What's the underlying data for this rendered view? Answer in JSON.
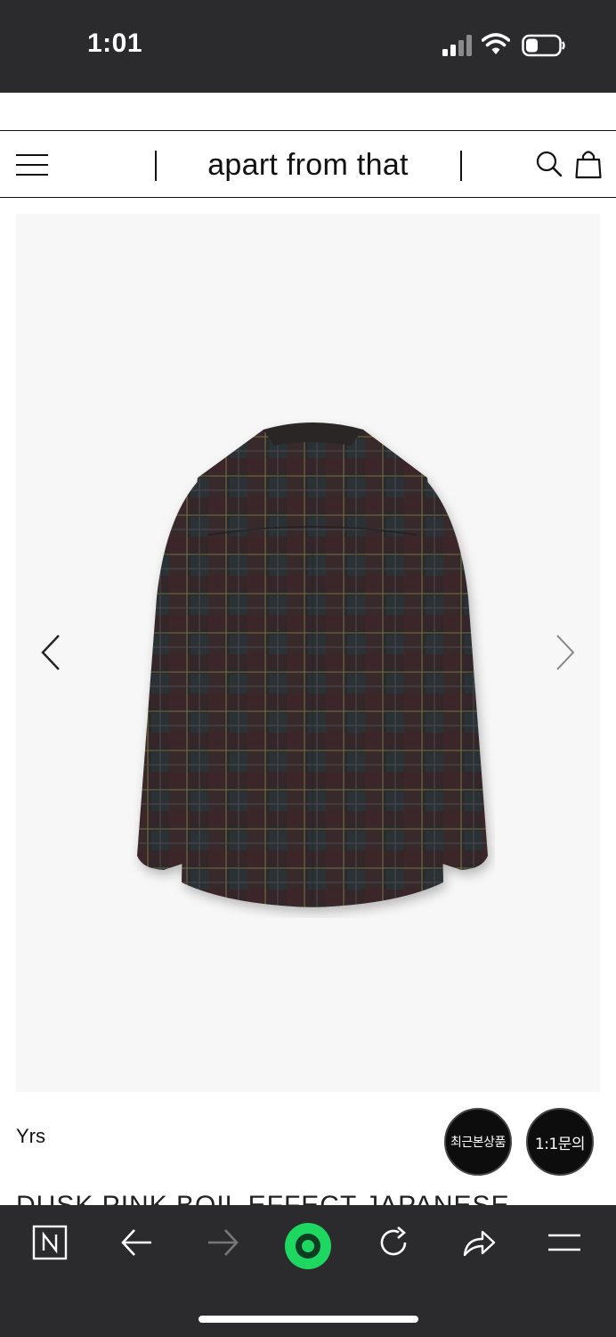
{
  "status_bar": {
    "time": "1:01"
  },
  "header": {
    "logo_text": "apart from that",
    "icons": [
      "menu-icon",
      "search-icon",
      "shopping-bag-icon"
    ]
  },
  "gallery": {
    "icons": [
      "chevron-left-icon",
      "chevron-right-icon"
    ],
    "image_subject": "dark plaid long-sleeve shirt, back view"
  },
  "product": {
    "brand": "Yrs",
    "title_partial": "DUSK PINK BOIL EFFECT JAPANESE"
  },
  "floating_buttons": {
    "recent_label": "최근본상품",
    "inquiry_label": "1:1문의"
  },
  "browser_toolbar": {
    "icons": [
      "naver-icon",
      "back-arrow-icon",
      "forward-arrow-icon",
      "home-circle-icon",
      "reload-icon",
      "share-icon",
      "menu-icon"
    ],
    "accent_color": "#1ed760"
  }
}
